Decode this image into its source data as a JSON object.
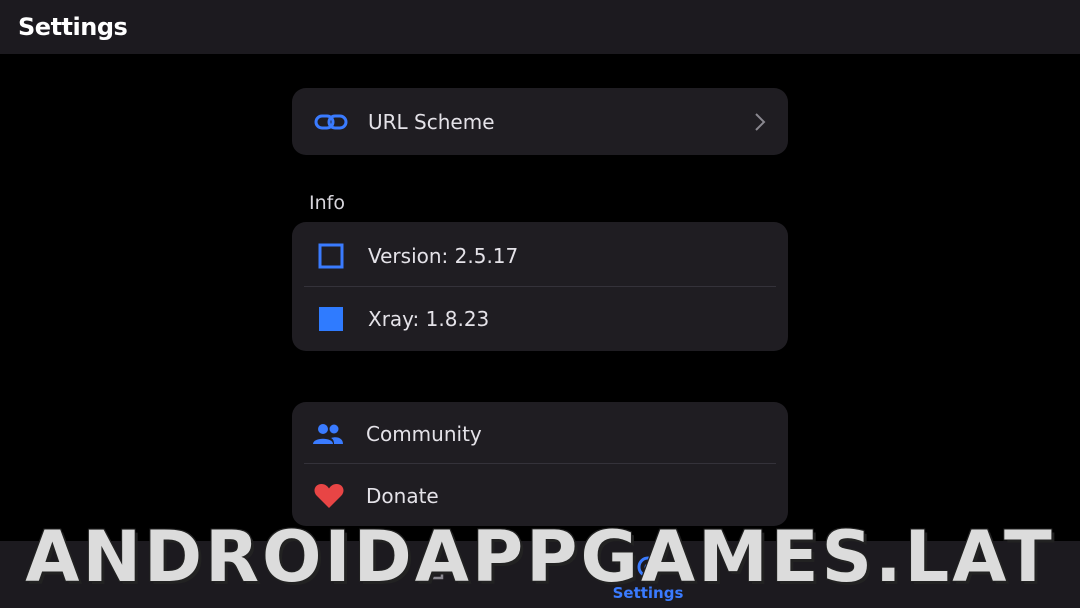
{
  "header": {
    "title": "Settings"
  },
  "url_scheme": {
    "label": "URL Scheme",
    "icon": "link-icon"
  },
  "info": {
    "section_title": "Info",
    "items": [
      {
        "label": "Version: 2.5.17",
        "icon": "square-outline-icon"
      },
      {
        "label": "Xray: 1.8.23",
        "icon": "square-filled-icon"
      }
    ]
  },
  "links": {
    "items": [
      {
        "label": "Community",
        "icon": "people-icon"
      },
      {
        "label": "Donate",
        "icon": "heart-icon"
      }
    ]
  },
  "bottom_nav": {
    "items": [
      {
        "label": "",
        "icon": "home-icon",
        "active": false
      },
      {
        "label": "Settings",
        "icon": "settings-icon",
        "active": true
      }
    ]
  },
  "watermark": "ANDROIDAPPGAMES.LAT",
  "colors": {
    "accent": "#3a7bff",
    "heart": "#e84545",
    "card": "#1f1d22",
    "bar": "#1c1a1f"
  }
}
